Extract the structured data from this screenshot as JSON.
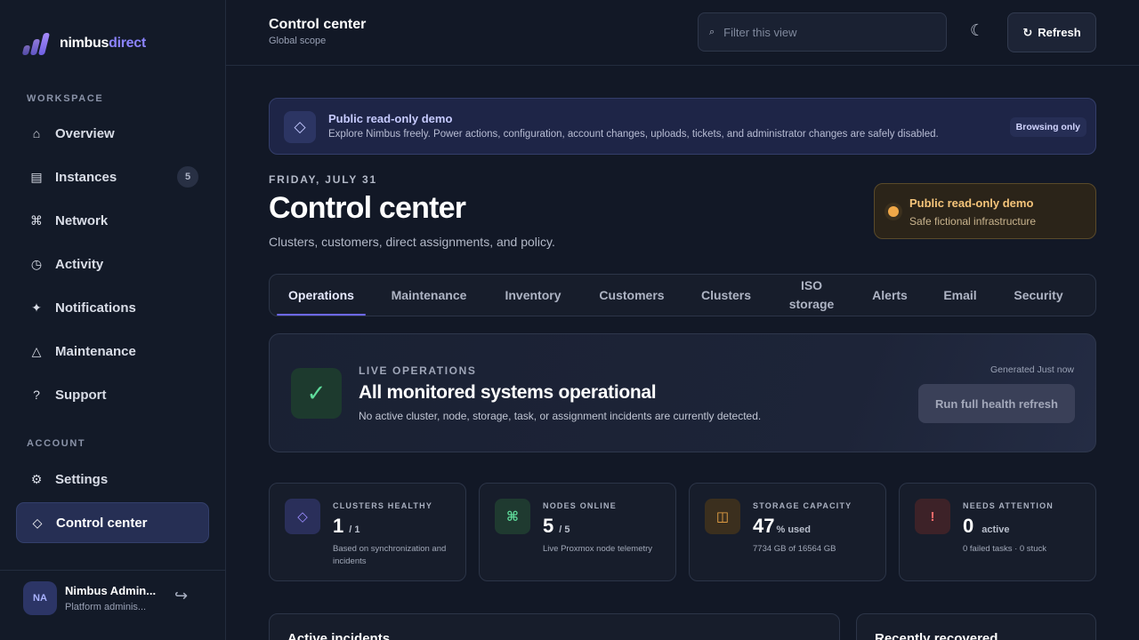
{
  "brand": {
    "name_a": "nimbus",
    "name_b": "direct"
  },
  "sidebar": {
    "workspace_label": "WORKSPACE",
    "account_label": "ACCOUNT",
    "items": [
      {
        "label": "Overview",
        "icon": "home-icon",
        "glyph": "⌂"
      },
      {
        "label": "Instances",
        "icon": "server-icon",
        "glyph": "▤",
        "count": "5"
      },
      {
        "label": "Network",
        "icon": "network-icon",
        "glyph": "⌘"
      },
      {
        "label": "Activity",
        "icon": "clock-icon",
        "glyph": "◷"
      },
      {
        "label": "Notifications",
        "icon": "sparkle-icon",
        "glyph": "✦"
      },
      {
        "label": "Maintenance",
        "icon": "warning-icon",
        "glyph": "△"
      },
      {
        "label": "Support",
        "icon": "help-icon",
        "glyph": "?"
      },
      {
        "label": "Settings",
        "icon": "gear-icon",
        "glyph": "⚙"
      },
      {
        "label": "Control center",
        "icon": "diamond-icon",
        "glyph": "◇"
      }
    ],
    "user": {
      "initials": "NA",
      "name": "Nimbus Admin...",
      "role": "Platform adminis...",
      "logout_glyph": "↪"
    }
  },
  "topbar": {
    "title": "Control center",
    "subtitle": "Global scope",
    "search_placeholder": "Filter this view",
    "theme_glyph": "☾",
    "refresh_label": "Refresh"
  },
  "banner": {
    "title": "Public read-only demo",
    "text": "Explore Nimbus freely. Power actions, configuration, account changes, uploads, tickets, and administrator changes are safely disabled.",
    "badge": "Browsing only"
  },
  "header": {
    "date": "FRIDAY, JULY 31",
    "title": "Control center",
    "subtitle": "Clusters, customers, direct assignments, and policy.",
    "demo_title": "Public read-only demo",
    "demo_sub": "Safe fictional infrastructure"
  },
  "tabs": [
    {
      "label": "Operations"
    },
    {
      "label": "Maintenance"
    },
    {
      "label": "Inventory"
    },
    {
      "label": "Customers"
    },
    {
      "label": "Clusters"
    },
    {
      "label": "ISO",
      "label2": "storage"
    },
    {
      "label": "Alerts"
    },
    {
      "label": "Email"
    },
    {
      "label": "Security"
    }
  ],
  "live": {
    "label": "LIVE OPERATIONS",
    "title": "All monitored systems operational",
    "text": "No active cluster, node, storage, task, or assignment incidents are currently detected.",
    "generated": "Generated Just now",
    "button": "Run full health refresh",
    "check_glyph": "✓"
  },
  "stats": [
    {
      "label": "CLUSTERS HEALTHY",
      "value": "1",
      "unit": "/ 1",
      "note": "Based on synchronization and incidents",
      "glyph": "◇",
      "color": "#9b8cff",
      "bg": "#2a2f5a"
    },
    {
      "label": "NODES ONLINE",
      "value": "5",
      "unit": "/ 5",
      "note": "Live Proxmox node telemetry",
      "glyph": "⌘",
      "color": "#5fdc9b",
      "bg": "#1f3a30"
    },
    {
      "label": "STORAGE CAPACITY",
      "value": "47",
      "unit": "% used",
      "note": "7734 GB of 16564 GB",
      "glyph": "◫",
      "color": "#f0a848",
      "bg": "#3b2f1e"
    },
    {
      "label": "NEEDS ATTENTION",
      "value": "0",
      "unit": "active",
      "note": "0 failed tasks · 0 stuck",
      "glyph": "!",
      "color": "#ff6b6b",
      "bg": "#3d2228"
    }
  ],
  "panels": [
    {
      "title": "Active incidents"
    },
    {
      "title": "Recently recovered"
    }
  ]
}
